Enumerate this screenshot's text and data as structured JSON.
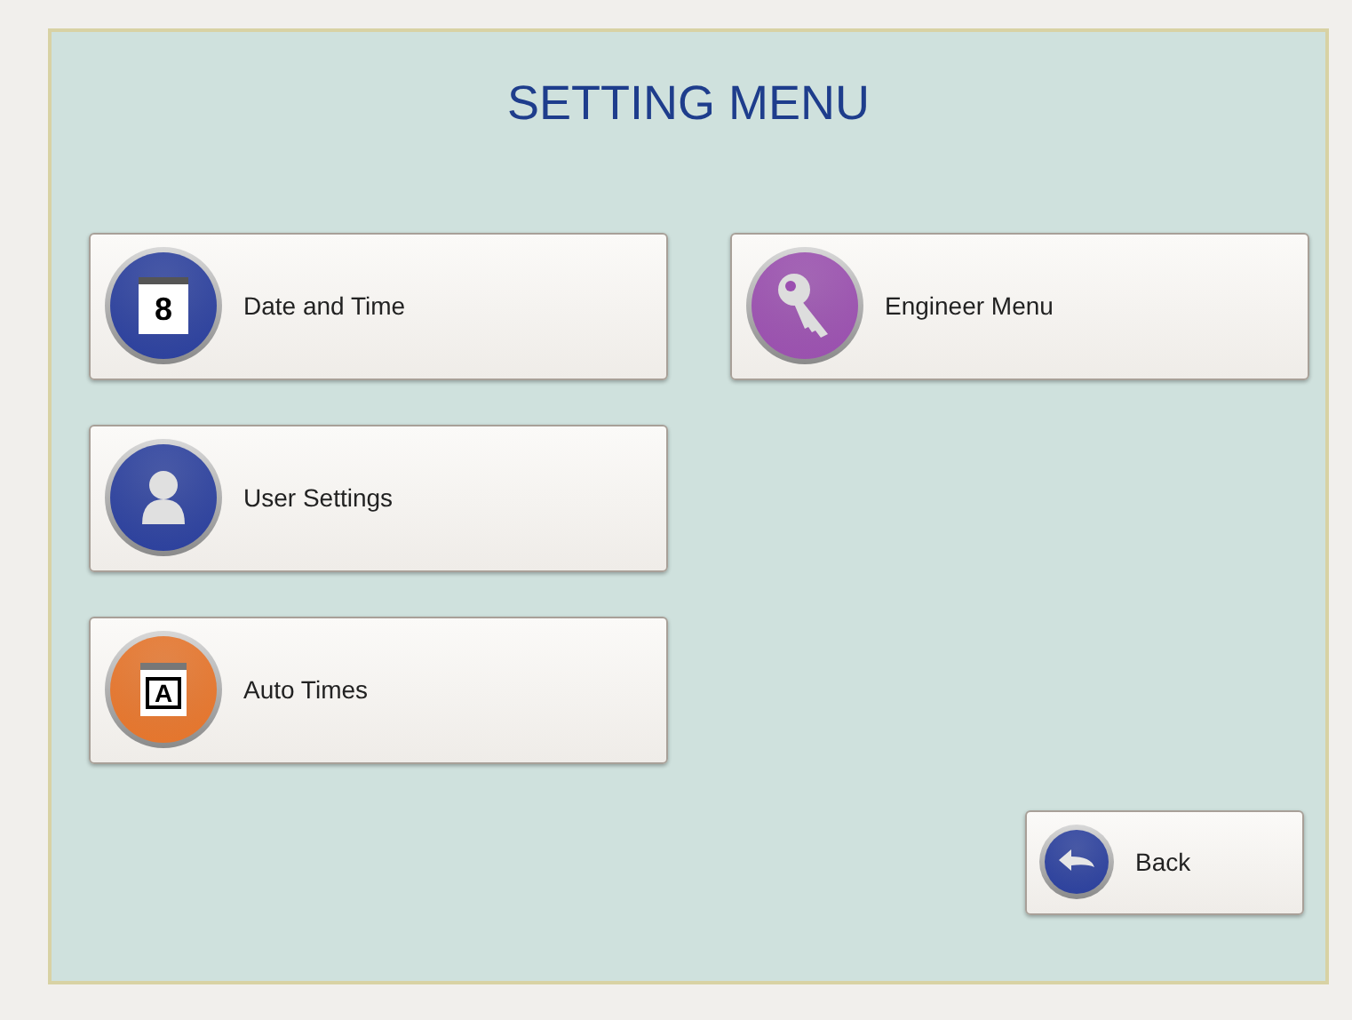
{
  "title": "SETTING MENU",
  "left_buttons": [
    {
      "label": "Date and Time",
      "kind": "calendar",
      "icon_text": "8"
    },
    {
      "label": "User Settings",
      "kind": "user"
    },
    {
      "label": "Auto Times",
      "kind": "notepad",
      "icon_text": "A"
    }
  ],
  "right_buttons": [
    {
      "label": "Engineer Menu",
      "kind": "key"
    }
  ],
  "back_button": {
    "label": "Back",
    "kind": "back"
  }
}
